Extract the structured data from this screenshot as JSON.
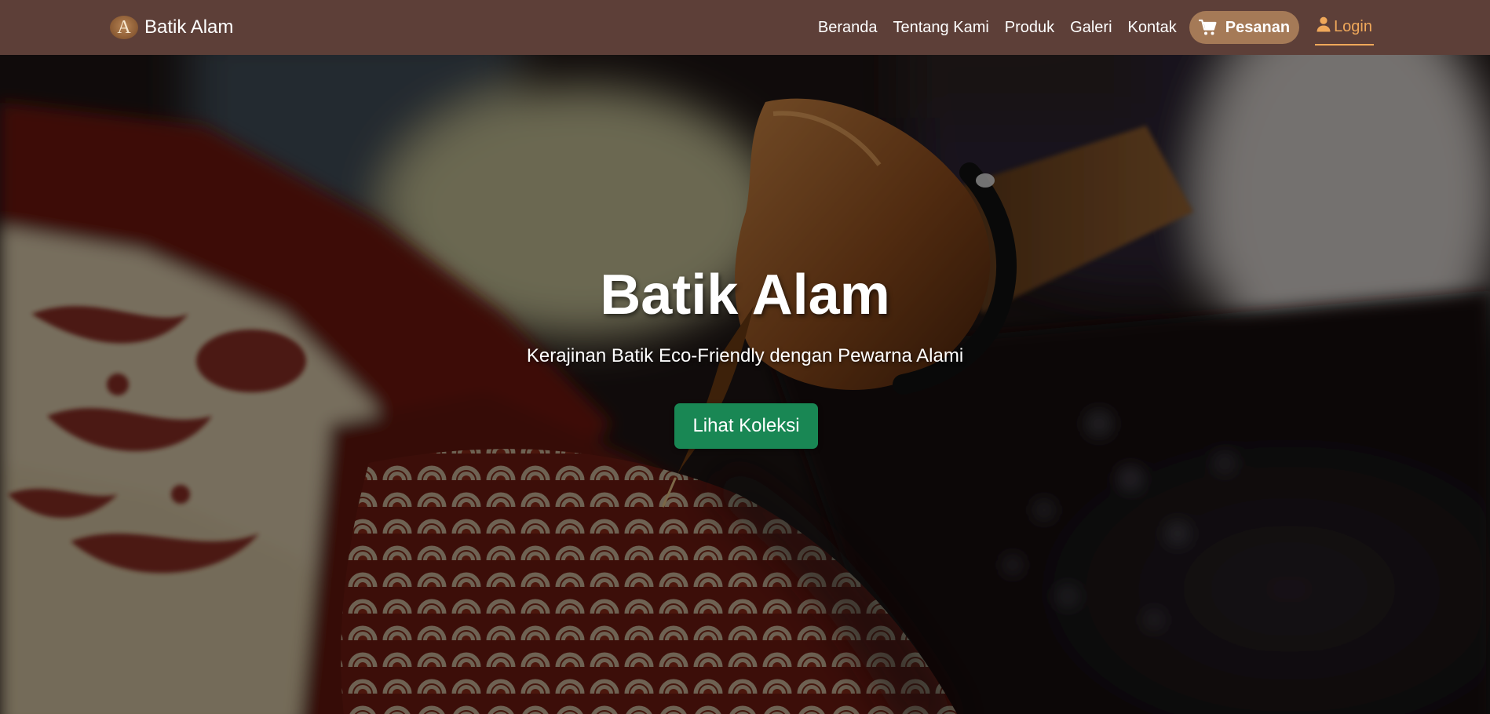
{
  "navbar": {
    "brand": {
      "logo_letter": "A",
      "name": "Batik Alam"
    },
    "links": [
      {
        "label": "Beranda"
      },
      {
        "label": "Tentang Kami"
      },
      {
        "label": "Produk"
      },
      {
        "label": "Galeri"
      },
      {
        "label": "Kontak"
      }
    ],
    "orders": {
      "label": "Pesanan",
      "icon": "shopping-cart-icon"
    },
    "login": {
      "label": "Login",
      "icon": "user-icon"
    }
  },
  "hero": {
    "title": "Batik Alam",
    "subtitle": "Kerajinan Batik Eco-Friendly dengan Pewarna Alami",
    "cta_label": "Lihat Koleksi"
  },
  "colors": {
    "navbar_bg": "#5d3f38",
    "orders_bg": "#a57a57",
    "login_accent": "#f0a85a",
    "cta_bg": "#198754"
  }
}
